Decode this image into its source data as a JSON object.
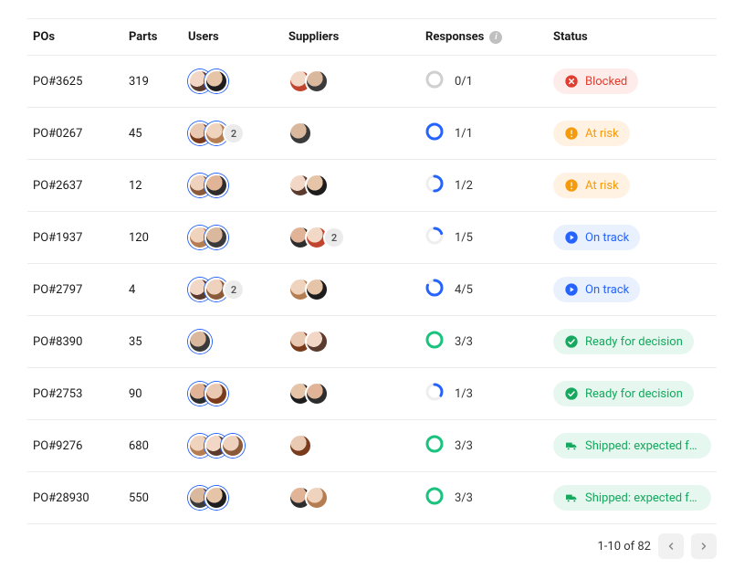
{
  "columns": {
    "po": "POs",
    "parts": "Parts",
    "users": "Users",
    "suppliers": "Suppliers",
    "responses": "Responses",
    "status": "Status"
  },
  "status_types": {
    "blocked": {
      "label": "Blocked",
      "css": "status-blocked",
      "icon": "x-circle"
    },
    "at-risk": {
      "label": "At risk",
      "css": "status-at-risk",
      "icon": "alert-circle"
    },
    "on-track": {
      "label": "On track",
      "css": "status-on-track",
      "icon": "play-circle"
    },
    "ready": {
      "label": "Ready for decision",
      "css": "status-ready",
      "icon": "check-circle"
    },
    "shipped": {
      "label": "Shipped: expected for…",
      "css": "status-shipped",
      "icon": "truck"
    }
  },
  "rows": [
    {
      "po": "PO#3625",
      "parts": "319",
      "users": [
        "a",
        "b"
      ],
      "users_more": null,
      "suppliers": [
        "f",
        "g"
      ],
      "suppliers_more": null,
      "responses": "0/1",
      "done": 0,
      "total": 1,
      "status": "blocked"
    },
    {
      "po": "PO#0267",
      "parts": "45",
      "users": [
        "c",
        "d"
      ],
      "users_more": "2",
      "suppliers": [
        "g"
      ],
      "suppliers_more": null,
      "responses": "1/1",
      "done": 1,
      "total": 1,
      "status": "at-risk"
    },
    {
      "po": "PO#2637",
      "parts": "12",
      "users": [
        "h",
        "e"
      ],
      "users_more": null,
      "suppliers": [
        "a",
        "b"
      ],
      "suppliers_more": null,
      "responses": "1/2",
      "done": 1,
      "total": 2,
      "status": "at-risk"
    },
    {
      "po": "PO#1937",
      "parts": "120",
      "users": [
        "d",
        "g"
      ],
      "users_more": null,
      "suppliers": [
        "e",
        "f"
      ],
      "suppliers_more": "2",
      "responses": "1/5",
      "done": 1,
      "total": 5,
      "status": "on-track"
    },
    {
      "po": "PO#2797",
      "parts": "4",
      "users": [
        "a",
        "h"
      ],
      "users_more": "2",
      "suppliers": [
        "d",
        "b"
      ],
      "suppliers_more": null,
      "responses": "4/5",
      "done": 4,
      "total": 5,
      "status": "on-track"
    },
    {
      "po": "PO#8390",
      "parts": "35",
      "users": [
        "g"
      ],
      "users_more": null,
      "suppliers": [
        "c",
        "a"
      ],
      "suppliers_more": null,
      "responses": "3/3",
      "done": 3,
      "total": 3,
      "status": "ready"
    },
    {
      "po": "PO#2753",
      "parts": "90",
      "users": [
        "e",
        "c"
      ],
      "users_more": null,
      "suppliers": [
        "b",
        "e"
      ],
      "suppliers_more": null,
      "responses": "1/3",
      "done": 1,
      "total": 3,
      "status": "ready"
    },
    {
      "po": "PO#9276",
      "parts": "680",
      "users": [
        "d",
        "a",
        "h"
      ],
      "users_more": null,
      "suppliers": [
        "c"
      ],
      "suppliers_more": null,
      "responses": "3/3",
      "done": 3,
      "total": 3,
      "status": "shipped"
    },
    {
      "po": "PO#28930",
      "parts": "550",
      "users": [
        "g",
        "b"
      ],
      "users_more": null,
      "suppliers": [
        "e",
        "d"
      ],
      "suppliers_more": null,
      "responses": "3/3",
      "done": 3,
      "total": 3,
      "status": "shipped"
    }
  ],
  "pagination": {
    "range": "1-10 of 82"
  }
}
